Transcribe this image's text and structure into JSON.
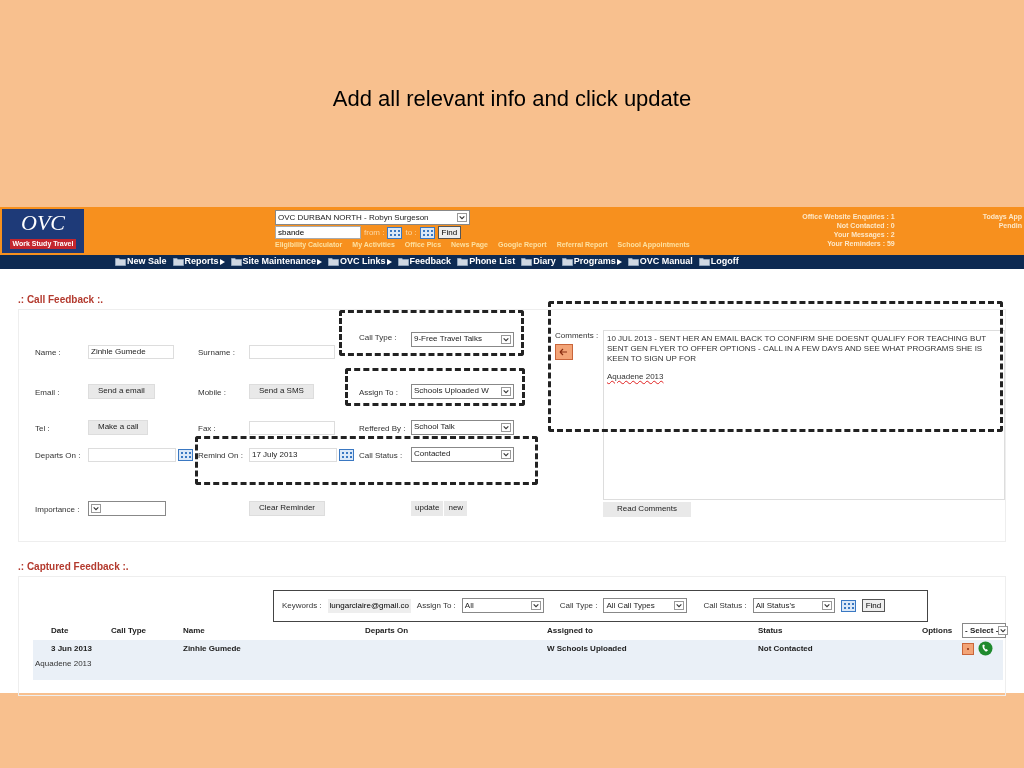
{
  "slide_title": "Add all relevant info and click update",
  "header": {
    "logo": {
      "letters": "OVC",
      "band": "Work Study Travel"
    },
    "office_select": "OVC DURBAN NORTH - Robyn Surgeson",
    "search": {
      "value": "sbande"
    },
    "from_label": "from :",
    "to_label": "to :",
    "find": "Find",
    "links": [
      "Eligibility Calculator",
      "My Activities",
      "Office Pics",
      "News Page",
      "Google Report",
      "Referral Report",
      "School Appointments"
    ],
    "stats": [
      "Office Website Enquiries : 1",
      "Not Contacted : 0",
      "Your Messages : 2",
      "Your Reminders : 59"
    ],
    "right_stats": [
      "Todays App",
      "Pendin"
    ]
  },
  "nav": [
    {
      "label": "New Sale",
      "submenu": false
    },
    {
      "label": "Reports",
      "submenu": true
    },
    {
      "label": "Site Maintenance",
      "submenu": true
    },
    {
      "label": "OVC Links",
      "submenu": true
    },
    {
      "label": "Feedback",
      "submenu": false
    },
    {
      "label": "Phone List",
      "submenu": false
    },
    {
      "label": "Diary",
      "submenu": false
    },
    {
      "label": "Programs",
      "submenu": true
    },
    {
      "label": "OVC Manual",
      "submenu": false
    },
    {
      "label": "Logoff",
      "submenu": false
    }
  ],
  "call_feedback": {
    "title": ".: Call Feedback :.",
    "rows": [
      [
        {
          "kind": "label",
          "text": "Name :"
        },
        {
          "kind": "input",
          "value": "Zinhle Gumede"
        },
        {
          "kind": "label",
          "text": "Surname :"
        },
        {
          "kind": "input"
        },
        {
          "kind": "label",
          "text": "Call Type :"
        },
        {
          "kind": "select",
          "value": "9-Free Travel Talks"
        }
      ],
      [
        {
          "kind": "label",
          "text": "Email :"
        },
        {
          "kind": "button",
          "text": "Send a email"
        },
        {
          "kind": "label",
          "text": "Mobile :"
        },
        {
          "kind": "button",
          "text": "Send a SMS"
        },
        {
          "kind": "label",
          "text": "Assign To :"
        },
        {
          "kind": "select",
          "value": "Schools Uploaded W"
        }
      ],
      [
        {
          "kind": "label",
          "text": "Tel :"
        },
        {
          "kind": "button",
          "text": "Make a call"
        },
        {
          "kind": "label",
          "text": "Fax :"
        },
        {
          "kind": "input"
        },
        {
          "kind": "label",
          "text": "Reffered By :"
        },
        {
          "kind": "select",
          "value": "School Talk"
        }
      ],
      [
        {
          "kind": "label",
          "text": "Departs On :"
        },
        {
          "kind": "date"
        },
        {
          "kind": "label",
          "text": "Remind On :"
        },
        {
          "kind": "date",
          "value": "17 July 2013"
        },
        {
          "kind": "label",
          "text": "Call Status :"
        },
        {
          "kind": "select",
          "value": "Contacted"
        }
      ],
      [
        {
          "kind": "label",
          "text": "Importance :"
        },
        {
          "kind": "select"
        },
        null,
        {
          "kind": "button",
          "text": "Clear Reminder"
        },
        null,
        {
          "kind": "buttons",
          "texts": [
            "update",
            "new"
          ]
        }
      ]
    ],
    "comments": {
      "label": "Comments :",
      "paragraphs": [
        "10 JUL 2013 - SENT HER AN EMAIL BACK TO CONFIRM SHE DOESNT QUALIFY FOR TEACHING BUT SENT GEN FLYER TO OFFER OPTIONS - CALL IN A FEW DAYS AND SEE WHAT PROGRAMS SHE IS KEEN TO SIGN UP FOR",
        "Aquadene 2013"
      ],
      "button": "Read Comments"
    }
  },
  "captured_feedback": {
    "title": ".: Captured Feedback :.",
    "filter": {
      "keywords_label": "Keywords :",
      "keywords": "lungarclaire@gmail.co",
      "assign_label": "Assign To :",
      "assign": "All",
      "call_type_label": "Call Type :",
      "call_type": "All Call Types",
      "call_status_label": "Call Status :",
      "call_status": "All Status's",
      "find": "Find"
    },
    "columns": [
      "Date",
      "Call Type",
      "Name",
      "Departs On",
      "Assigned to",
      "Status",
      "Options"
    ],
    "options_select": "- Select -",
    "rows": [
      {
        "date": "3 Jun 2013",
        "name": "Zinhle Gumede",
        "assigned_to": "W Schools Uploaded",
        "status": "Not Contacted",
        "note": "Aquadene 2013"
      }
    ]
  }
}
